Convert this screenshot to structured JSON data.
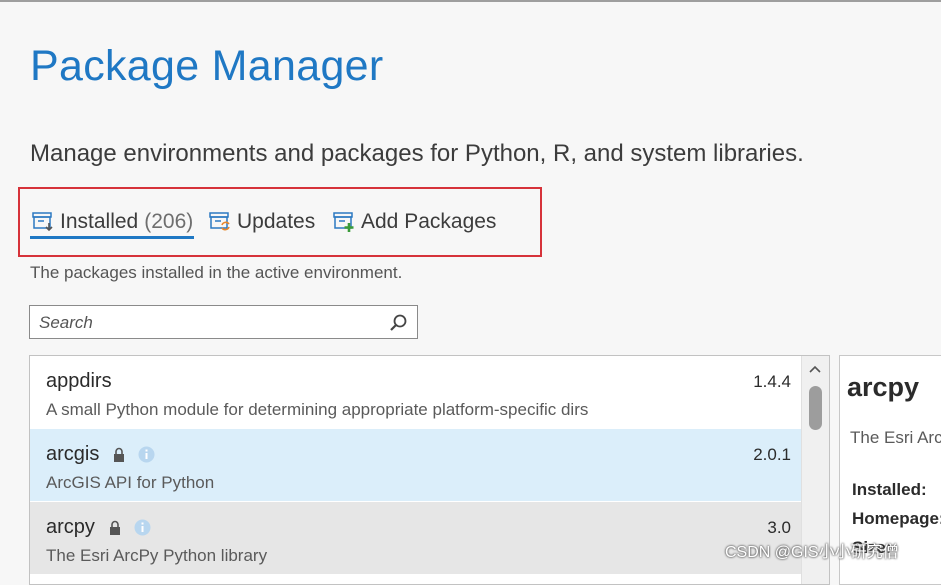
{
  "page": {
    "title": "Package Manager",
    "subtitle": "Manage environments and packages for Python, R, and system libraries."
  },
  "tabs": {
    "installed": {
      "label": "Installed",
      "count": "(206)"
    },
    "updates": {
      "label": "Updates"
    },
    "add": {
      "label": "Add Packages"
    }
  },
  "tab_description": "The packages installed in the active environment.",
  "search": {
    "placeholder": "Search",
    "value": ""
  },
  "packages": [
    {
      "name": "appdirs",
      "version": "1.4.4",
      "description": "A small Python module for determining appropriate platform-specific dirs"
    },
    {
      "name": "arcgis",
      "version": "2.0.1",
      "description": "ArcGIS API for Python"
    },
    {
      "name": "arcpy",
      "version": "3.0",
      "description": "The Esri ArcPy Python library"
    }
  ],
  "detail": {
    "name": "arcpy",
    "description": "The Esri ArcPy Python library",
    "installed_label": "Installed:",
    "homepage_label": "Homepage:",
    "size_label": "Size:"
  },
  "watermark": "CSDN @GIS小小研究僧",
  "colors": {
    "accent": "#1f78c4",
    "highlight_box": "#d6323a",
    "selected_row": "#dbeefa",
    "hover_row": "#e6e6e6"
  }
}
